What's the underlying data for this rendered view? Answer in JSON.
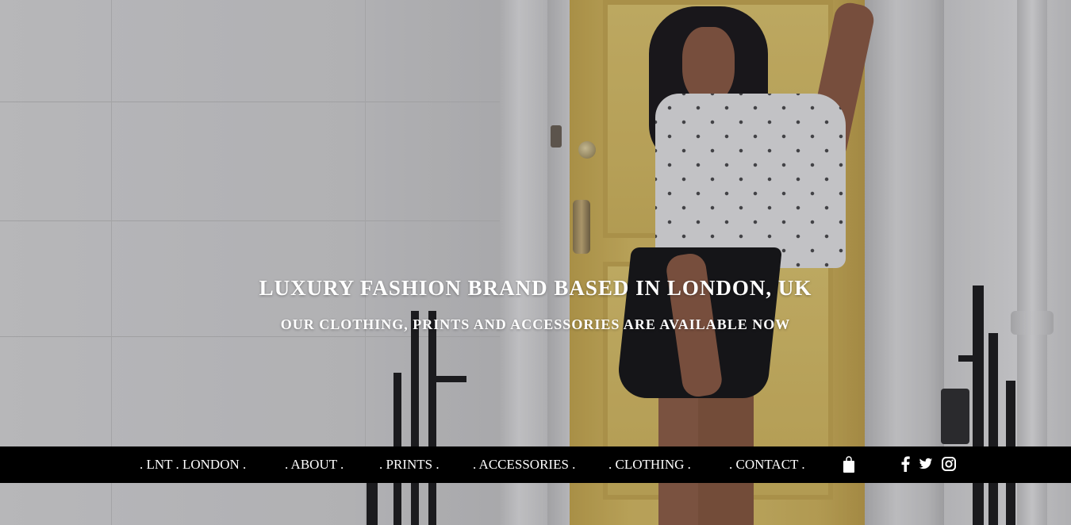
{
  "hero": {
    "headline": "LUXURY FASHION BRAND BASED IN LONDON, UK",
    "subline": "OUR CLOTHING, PRINTS AND ACCESSORIES ARE AVAILABLE NOW"
  },
  "nav": {
    "items": [
      {
        "label": ". LNT . LONDON ."
      },
      {
        "label": ". ABOUT ."
      },
      {
        "label": ". PRINTS ."
      },
      {
        "label": ". ACCESSORIES ."
      },
      {
        "label": ". CLOTHING ."
      },
      {
        "label": ". CONTACT ."
      }
    ],
    "icons": [
      "shopping-bag-icon",
      "facebook-icon",
      "twitter-icon",
      "instagram-icon"
    ]
  },
  "colors": {
    "navbar_bg": "#000000",
    "nav_text": "#ffffff",
    "hero_text": "#ffffff",
    "door": "#dcc36c"
  }
}
